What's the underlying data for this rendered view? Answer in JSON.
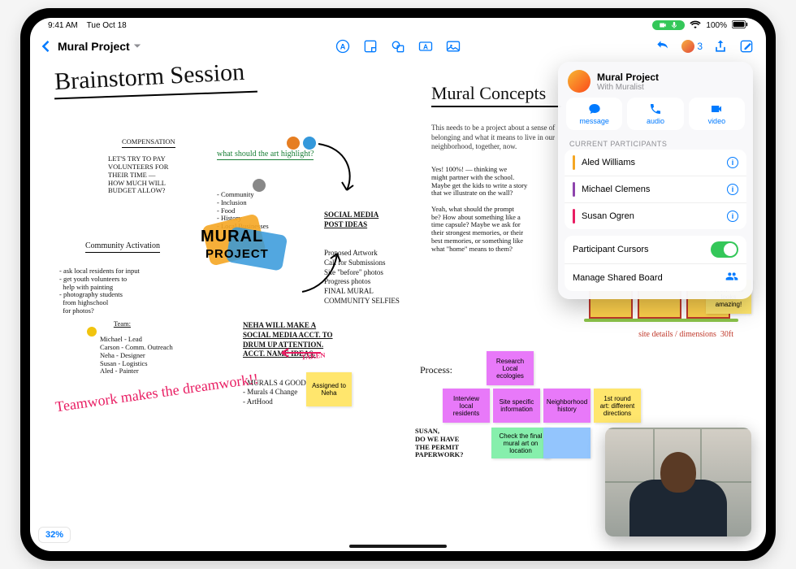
{
  "status": {
    "time": "9:41 AM",
    "date": "Tue Oct 18",
    "battery": "100%"
  },
  "toolbar": {
    "title": "Mural Project",
    "collab_count": "3"
  },
  "popover": {
    "title": "Mural Project",
    "subtitle": "With Muralist",
    "actions": {
      "message": "message",
      "audio": "audio",
      "video": "video"
    },
    "section_label": "CURRENT PARTICIPANTS",
    "participants": [
      {
        "name": "Aled Williams",
        "color": "#f5a623"
      },
      {
        "name": "Michael Clemens",
        "color": "#8e44ad"
      },
      {
        "name": "Susan Ogren",
        "color": "#e91e63"
      }
    ],
    "cursors_label": "Participant Cursors",
    "manage_label": "Manage Shared Board"
  },
  "canvas": {
    "title": "Brainstorm Session",
    "compensation": {
      "head": "COMPENSATION",
      "body": "LET'S TRY TO PAY\nVOLUNTEERS FOR\nTHEIR TIME —\nHOW MUCH WILL\nBUDGET ALLOW?"
    },
    "highlight": {
      "head": "what should the art highlight?",
      "items": "- Community\n- Inclusion\n- Food\n- History\n- Local Businesses"
    },
    "community": {
      "head": "Community Activation",
      "body": "- ask local residents for input\n- get youth volunteers to\n  help with painting\n- photography students\n  from highschool\n  for photos?"
    },
    "team": {
      "head": "Team:",
      "body": "Michael - Lead\nCarson - Comm. Outreach\nNeha - Designer\nSusan - Logistics\nAled - Painter"
    },
    "social": {
      "head": "SOCIAL MEDIA\nPOST IDEAS",
      "body": "Proposed Artwork\nCall for Submissions\nSite \"before\" photos\nProgress photos\nFINAL MURAL\nCOMMUNITY SELFIES"
    },
    "neha": {
      "body": "NEHA WILL MAKE A\nSOCIAL MEDIA ACCT. TO\nDRUM UP ATTENTION.\nACCT. NAME IDEAS:",
      "ideas": "- MURALS 4 GOOD\n- Murals 4 Change\n- ArtHood",
      "taken": "TAKEN"
    },
    "teamwork": "Teamwork\nmakes the\ndreamwork!!",
    "assigned_sticky": "Assigned to\nNeha",
    "concepts_title": "Mural Concepts",
    "concepts_intro": "This needs to be a project about a\nsense of belonging and what it\nmeans to live in our neighborhood,\ntogether, now.",
    "concepts_notes": "Yes! 100%! — thinking we\nmight partner with the school.\nMaybe get the kids to write a story\nthat we illustrate on the wall?\n\nYeah, what should the prompt\nbe? How about something like a\ntime capsule? Maybe we ask for\ntheir strongest memories, or their\nbest memories, or something like\nwhat \"home\" means to them?",
    "site_note": "site details / dimensions  30ft",
    "wow_sticky": "Wow! This\nlooks amazing!",
    "process_head": "Process:",
    "process": {
      "a": "Research Local\necologies",
      "b": "Interview\nlocal residents",
      "c": "Site specific\ninformation",
      "d": "Neighborhood\nhistory",
      "e": "1st round\nart: different\ndirections",
      "f": "Check the final\nmural art on\nlocation"
    },
    "susan_note": "SUSAN,\nDO WE HAVE\nTHE PERMIT\nPAPERWORK?",
    "mural_logo": {
      "line1": "MURAL",
      "line2": "PROJECT"
    },
    "zoom": "32%"
  }
}
